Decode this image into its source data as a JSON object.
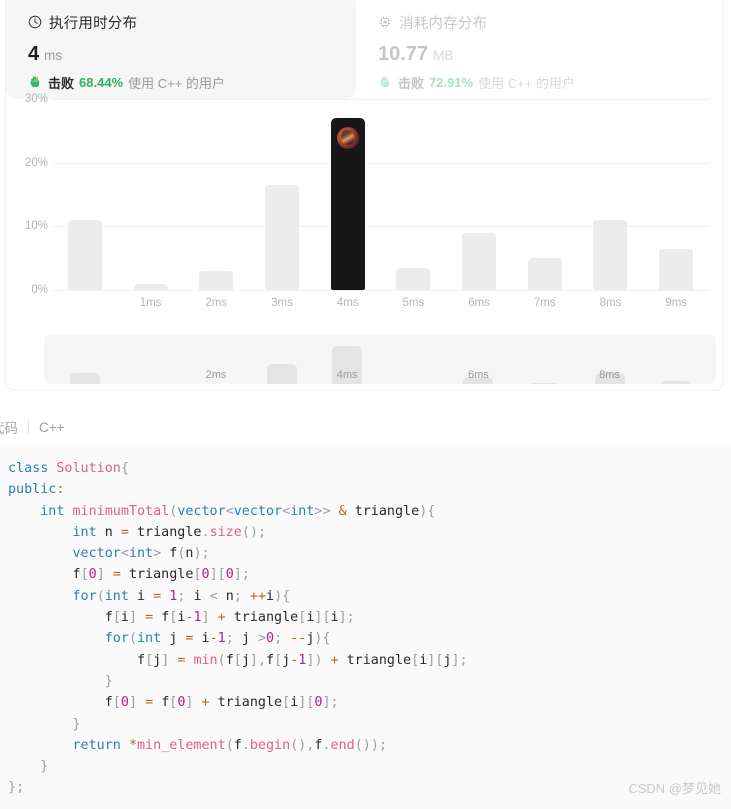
{
  "runtime_panel": {
    "icon": "clock-icon",
    "title": "执行用时分布",
    "value": "4",
    "unit": "ms",
    "hand_icon": "raised-hand-icon",
    "beat_label": "击败",
    "beat_percent": "68.44%",
    "beat_suffix": "使用 C++ 的用户",
    "accent_color": "#2db55d"
  },
  "memory_panel": {
    "icon": "chip-icon",
    "title": "消耗内存分布",
    "value": "10.77",
    "unit": "MB",
    "hand_icon": "raised-hand-icon",
    "beat_label": "击败",
    "beat_percent": "72.91%",
    "beat_suffix": "使用 C++ 的用户",
    "accent_color": "#a8e2bd"
  },
  "chart_data": {
    "type": "bar",
    "title": "执行用时分布",
    "xlabel": "",
    "ylabel": "",
    "ylim": [
      0,
      30
    ],
    "yticks": [
      "0%",
      "10%",
      "20%",
      "30%"
    ],
    "ytick_values": [
      0,
      10,
      20,
      30
    ],
    "grid": true,
    "legend": "none",
    "categories": [
      "",
      "1ms",
      "2ms",
      "3ms",
      "4ms",
      "5ms",
      "6ms",
      "7ms",
      "8ms",
      "9ms"
    ],
    "values": [
      11,
      1,
      3,
      16.5,
      27,
      3.5,
      9,
      5,
      11,
      6.5
    ],
    "highlighted_index": 4,
    "highlight_color": "#171717",
    "bar_color": "#ececec",
    "annotation": "user-avatar-marker"
  },
  "minimap": {
    "labels": [
      "",
      "",
      "2ms",
      "",
      "4ms",
      "",
      "6ms",
      "",
      "8ms",
      ""
    ],
    "values": [
      11,
      1,
      3,
      16.5,
      27,
      3.5,
      9,
      5,
      11,
      6.5
    ]
  },
  "code_header": {
    "tab_label": "代码",
    "language": "C++"
  },
  "code": {
    "lines": [
      "class Solution{",
      "public:",
      "    int minimumTotal(vector<vector<int>> & triangle){",
      "        int n = triangle.size();",
      "        vector<int> f(n);",
      "        f[0] = triangle[0][0];",
      "        for(int i = 1; i < n; ++i){",
      "            f[i] = f[i-1] + triangle[i][i];",
      "            for(int j = i-1; j >0; --j){",
      "                f[j] = min(f[j],f[j-1]) + triangle[i][j];",
      "            }",
      "            f[0] = f[0] + triangle[i][0];",
      "        }",
      "        return *min_element(f.begin(),f.end());",
      "    }",
      "};"
    ]
  },
  "watermark": {
    "text": "CSDN @梦见她"
  }
}
